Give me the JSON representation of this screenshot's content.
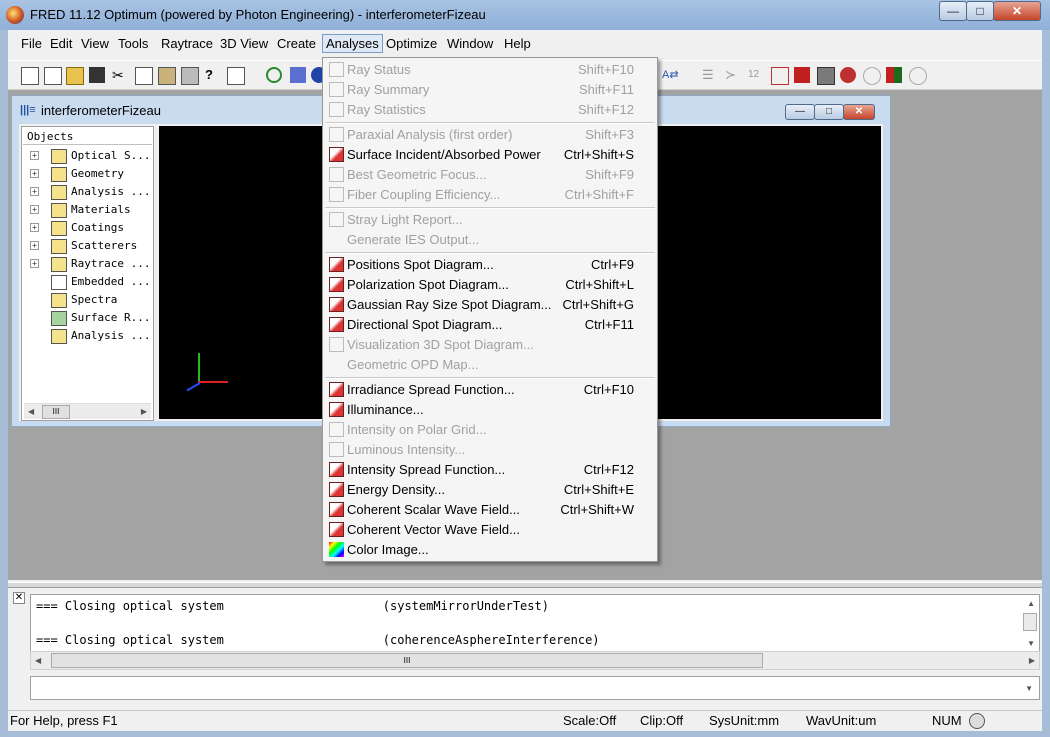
{
  "window": {
    "title": "FRED 11.12 Optimum (powered by Photon Engineering) - interferometerFizeau",
    "controls": {
      "minimize": "—",
      "maximize": "□",
      "close": "✕"
    }
  },
  "menubar": {
    "items": [
      "File",
      "Edit",
      "View",
      "Tools",
      "Raytrace",
      "3D View",
      "Create",
      "Analyses",
      "Optimize",
      "Window",
      "Help"
    ],
    "active": "Analyses"
  },
  "child_window": {
    "title": "interferometerFizeau",
    "icon": "table-icon",
    "tree_header": "Objects",
    "tree": [
      {
        "label": "Optical S...",
        "expandable": true
      },
      {
        "label": "Geometry",
        "expandable": true
      },
      {
        "label": "Analysis ...",
        "expandable": true
      },
      {
        "label": "Materials",
        "expandable": true
      },
      {
        "label": "Coatings",
        "expandable": true
      },
      {
        "label": "Scatterers",
        "expandable": true
      },
      {
        "label": "Raytrace ...",
        "expandable": true
      },
      {
        "label": "Embedded ...",
        "expandable": false
      },
      {
        "label": "Spectra",
        "expandable": false
      },
      {
        "label": "Surface R...",
        "expandable": false
      },
      {
        "label": "Analysis ...",
        "expandable": false
      }
    ]
  },
  "analyses_menu": {
    "items": [
      {
        "label": "Ray Status",
        "shortcut": "Shift+F10",
        "enabled": false,
        "icon": "list-icon"
      },
      {
        "label": "Ray Summary",
        "shortcut": "Shift+F11",
        "enabled": false,
        "icon": "rays-icon"
      },
      {
        "label": "Ray Statistics",
        "shortcut": "Shift+F12",
        "enabled": false,
        "icon": "stats-icon"
      },
      {
        "separator": true
      },
      {
        "label": "Paraxial Analysis (first order)",
        "shortcut": "Shift+F3",
        "enabled": false,
        "icon": "paraxial-icon"
      },
      {
        "label": "Surface Incident/Absorbed Power",
        "shortcut": "Ctrl+Shift+S",
        "enabled": true,
        "icon": "power-icon"
      },
      {
        "label": "Best Geometric Focus...",
        "shortcut": "Shift+F9",
        "enabled": false,
        "icon": "focus-icon"
      },
      {
        "label": "Fiber Coupling Efficiency...",
        "shortcut": "Ctrl+Shift+F",
        "enabled": false,
        "icon": "fiber-icon"
      },
      {
        "separator": true
      },
      {
        "label": "Stray Light Report...",
        "shortcut": "",
        "enabled": false,
        "icon": "stray-light-icon"
      },
      {
        "label": "Generate IES Output...",
        "shortcut": "",
        "enabled": false,
        "icon": ""
      },
      {
        "separator": true
      },
      {
        "label": "Positions Spot Diagram...",
        "shortcut": "Ctrl+F9",
        "enabled": true,
        "icon": "spot-diagram-icon"
      },
      {
        "label": "Polarization Spot Diagram...",
        "shortcut": "Ctrl+Shift+L",
        "enabled": true,
        "icon": "polarization-icon"
      },
      {
        "label": "Gaussian Ray Size Spot Diagram...",
        "shortcut": "Ctrl+Shift+G",
        "enabled": true,
        "icon": "gaussian-icon"
      },
      {
        "label": "Directional Spot Diagram...",
        "shortcut": "Ctrl+F11",
        "enabled": true,
        "icon": "directional-icon"
      },
      {
        "label": "Visualization 3D Spot Diagram...",
        "shortcut": "",
        "enabled": false,
        "icon": "3d-spot-icon"
      },
      {
        "label": "Geometric OPD Map...",
        "shortcut": "",
        "enabled": false,
        "icon": ""
      },
      {
        "separator": true
      },
      {
        "label": "Irradiance Spread Function...",
        "shortcut": "Ctrl+F10",
        "enabled": true,
        "icon": "irradiance-icon"
      },
      {
        "label": "Illuminance...",
        "shortcut": "",
        "enabled": true,
        "icon": "illuminance-icon"
      },
      {
        "label": "Intensity on Polar Grid...",
        "shortcut": "",
        "enabled": false,
        "icon": "polar-grid-icon"
      },
      {
        "label": "Luminous Intensity...",
        "shortcut": "",
        "enabled": false,
        "icon": "luminous-icon"
      },
      {
        "label": "Intensity Spread Function...",
        "shortcut": "Ctrl+F12",
        "enabled": true,
        "icon": "intensity-icon"
      },
      {
        "label": "Energy Density...",
        "shortcut": "Ctrl+Shift+E",
        "enabled": true,
        "icon": "energy-icon"
      },
      {
        "label": "Coherent Scalar Wave Field...",
        "shortcut": "Ctrl+Shift+W",
        "enabled": true,
        "icon": "scalar-wave-icon"
      },
      {
        "label": "Coherent Vector Wave Field...",
        "shortcut": "",
        "enabled": true,
        "icon": "vector-wave-icon"
      },
      {
        "label": "Color Image...",
        "shortcut": "",
        "enabled": true,
        "icon": "color-image-icon"
      }
    ]
  },
  "output": {
    "lines": [
      "=== Closing optical system                      (systemMirrorUnderTest)",
      "=== Closing optical system                      (coherenceAsphereInterference)"
    ],
    "scroll_grip": "III"
  },
  "statusbar": {
    "help": "For Help, press F1",
    "scale": "Scale:Off",
    "clip": "Clip:Off",
    "sysunit": "SysUnit:mm",
    "wavunit": "WavUnit:um",
    "num": "NUM"
  },
  "colors": {
    "canvas": "#000000",
    "titlebar": "#a8c3e3",
    "menu_bg": "#f5f5f5",
    "disabled_text": "#a0a0a0"
  }
}
